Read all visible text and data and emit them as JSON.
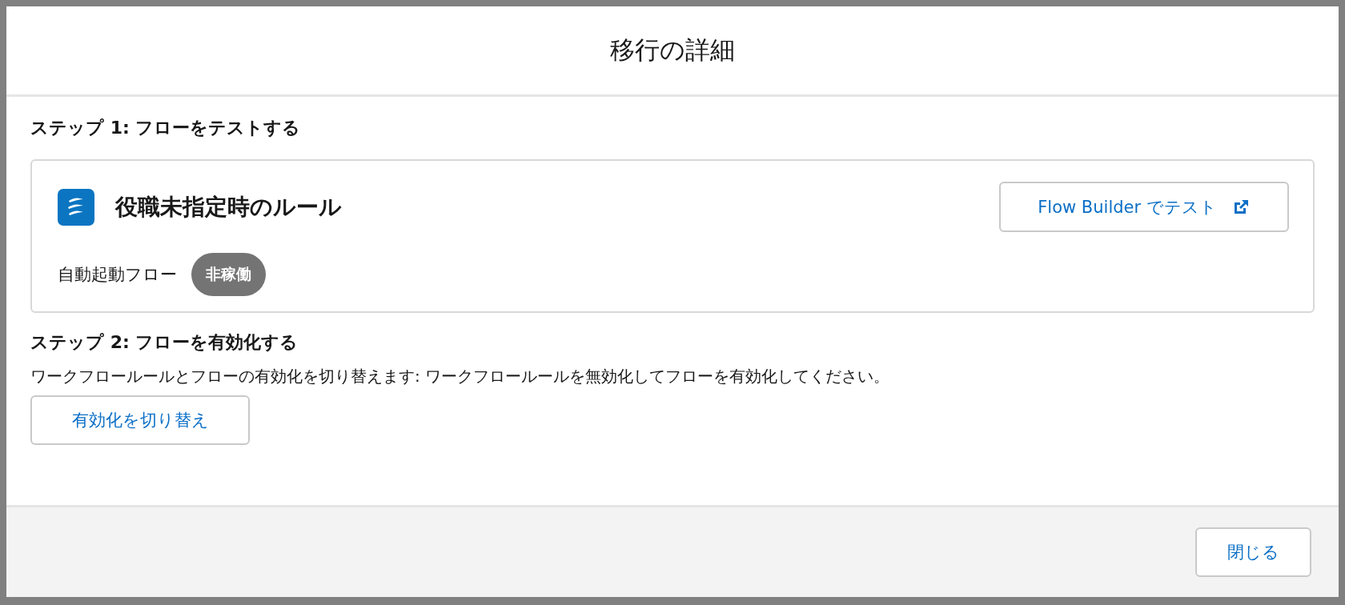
{
  "modal": {
    "title": "移行の詳細"
  },
  "step1": {
    "heading": "ステップ 1: フローをテストする",
    "flow": {
      "name": "役職未指定時のルール",
      "type": "自動起動フロー",
      "status": "非稼働",
      "active": false
    },
    "test_button": "Flow Builder でテスト"
  },
  "step2": {
    "heading": "ステップ 2: フローを有効化する",
    "description": "ワークフロールールとフローの有効化を切り替えます: ワークフロールールを無効化してフローを有効化してください。",
    "toggle_button": "有効化を切り替え"
  },
  "footer": {
    "close_button": "閉じる"
  }
}
